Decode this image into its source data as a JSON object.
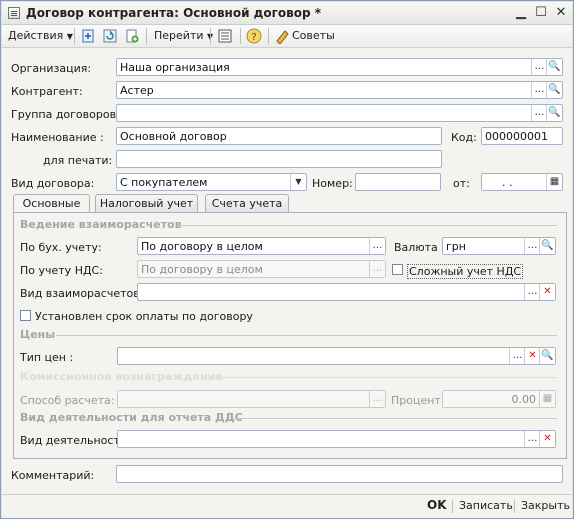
{
  "window": {
    "title": "Договор контрагента: Основной договор *"
  },
  "toolbar": {
    "actions": "Действия",
    "goto": "Перейти",
    "advice": "Советы"
  },
  "form": {
    "org_label": "Организация:",
    "org_value": "Наша организация",
    "counterparty_label": "Контрагент:",
    "counterparty_value": "Астер",
    "group_label": "Группа договоров:",
    "group_value": "",
    "name_label": "Наименование :",
    "name_value": "Основной договор",
    "code_label": "Код:",
    "code_value": "000000001",
    "print_label": "для печати:",
    "print_value": "",
    "type_label": "Вид договора:",
    "type_value": "С покупателем",
    "number_label": "Номер:",
    "number_value": "",
    "from_label": "от:",
    "date_value": " .  .  ",
    "comment_label": "Комментарий:",
    "comment_value": ""
  },
  "tabs": [
    "Основные",
    "Налоговый учет",
    "Счета учета"
  ],
  "main": {
    "settlements_section": "Ведение взаиморасчетов",
    "acc_label": "По бух. учету:",
    "acc_value": "По договору в целом",
    "currency_label": "Валюта :",
    "currency_value": "грн",
    "vat_label": "По учету НДС:",
    "vat_value": "По договору в целом",
    "complex_vat": "Сложный  учет НДС",
    "settlement_type_label": "Вид взаиморасчетов:",
    "settlement_type_value": "",
    "payment_term": "Установлен срок оплаты по договору",
    "prices_section": "Цены",
    "price_type_label": "Тип цен :",
    "price_type_value": "",
    "commission_section": "Комиссионное вознаграждение",
    "calc_label": "Способ расчета:",
    "calc_value": "",
    "percent_label": "Процент:",
    "percent_value": "0.00",
    "activity_section": "Вид деятельности для отчета ДДС",
    "activity_label": "Вид деятельности:",
    "activity_value": ""
  },
  "footer": {
    "ok": "OK",
    "save": "Записать",
    "close": "Закрыть"
  }
}
